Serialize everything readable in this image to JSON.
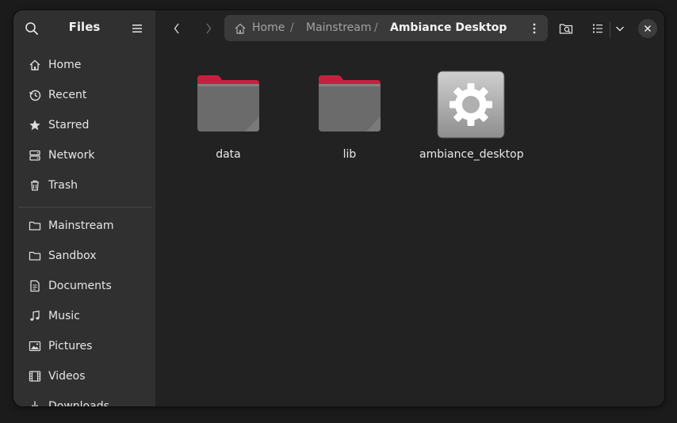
{
  "sidebar": {
    "title": "Files",
    "places": [
      {
        "label": "Home",
        "icon": "home-icon"
      },
      {
        "label": "Recent",
        "icon": "recent-icon"
      },
      {
        "label": "Starred",
        "icon": "star-icon"
      },
      {
        "label": "Network",
        "icon": "network-icon"
      },
      {
        "label": "Trash",
        "icon": "trash-icon"
      }
    ],
    "bookmarks": [
      {
        "label": "Mainstream",
        "icon": "folder-icon"
      },
      {
        "label": "Sandbox",
        "icon": "folder-icon"
      },
      {
        "label": "Documents",
        "icon": "documents-icon"
      },
      {
        "label": "Music",
        "icon": "music-icon"
      },
      {
        "label": "Pictures",
        "icon": "pictures-icon"
      },
      {
        "label": "Videos",
        "icon": "videos-icon"
      },
      {
        "label": "Downloads",
        "icon": "downloads-icon"
      }
    ]
  },
  "pathbar": {
    "crumbs": [
      "Home",
      "Mainstream",
      "Ambiance Desktop"
    ],
    "separator": "/"
  },
  "files": [
    {
      "name": "data",
      "type": "folder"
    },
    {
      "name": "lib",
      "type": "folder"
    },
    {
      "name": "ambiance_desktop",
      "type": "executable"
    }
  ],
  "colors": {
    "folder_accent": "#c7203f",
    "folder_body": "#6b6b6b",
    "sidebar_bg": "#303030",
    "content_bg": "#222222"
  }
}
